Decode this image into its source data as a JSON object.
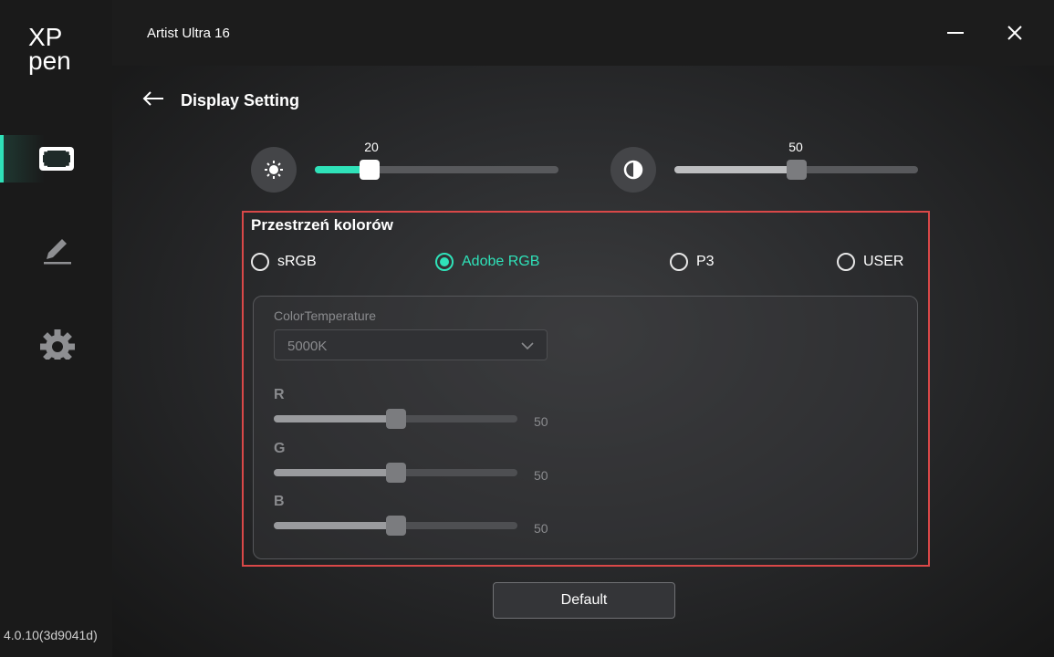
{
  "sidebar": {
    "logo_line1": "XP",
    "logo_line2": "pen",
    "items": [
      {
        "icon": "display-frame-icon",
        "active": true
      },
      {
        "icon": "pen-icon",
        "active": false
      },
      {
        "icon": "gear-icon",
        "active": false
      }
    ],
    "version": "4.0.10(3d9041d)"
  },
  "titlebar": {
    "title": "Artist Ultra 16",
    "minimize_icon": "minimize-icon",
    "close_icon": "close-icon"
  },
  "header": {
    "back_icon": "back-arrow-icon",
    "title": "Display Setting"
  },
  "brightness": {
    "icon": "brightness-icon",
    "value": "20",
    "fraction": 0.2
  },
  "contrast": {
    "icon": "contrast-icon",
    "value": "50",
    "fraction": 0.5
  },
  "colorspace": {
    "title": "Przestrzeń kolorów",
    "options": [
      {
        "label": "sRGB",
        "checked": false
      },
      {
        "label": "Adobe RGB",
        "checked": true
      },
      {
        "label": "P3",
        "checked": false
      },
      {
        "label": "USER",
        "checked": false
      }
    ]
  },
  "color_temperature": {
    "label": "ColorTemperature",
    "selected": "5000K"
  },
  "rgb": [
    {
      "label": "R",
      "value": "50",
      "fraction": 0.5
    },
    {
      "label": "G",
      "value": "50",
      "fraction": 0.5
    },
    {
      "label": "B",
      "value": "50",
      "fraction": 0.5
    }
  ],
  "footer": {
    "default_label": "Default"
  },
  "colors": {
    "accent": "#2fe2b9",
    "highlight_border": "#d94848",
    "disabled_thumb": "#7b7c7f",
    "active_thumb": "#ffffff"
  }
}
